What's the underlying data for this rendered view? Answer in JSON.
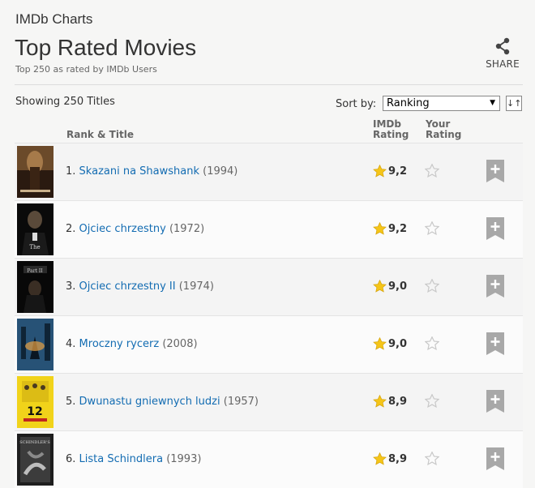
{
  "header": {
    "charts_label": "IMDb Charts",
    "title": "Top Rated Movies",
    "subtitle": "Top 250 as rated by IMDb Users",
    "share_label": "SHARE"
  },
  "toolbar": {
    "showing": "Showing 250 Titles",
    "sort_label": "Sort by:",
    "sort_value": "Ranking",
    "sort_caret": "▼",
    "sort_dir_glyph": "↓↑"
  },
  "columns": {
    "rank_title": "Rank & Title",
    "imdb_rating_1": "IMDb",
    "imdb_rating_2": "Rating",
    "your_rating_1": "Your",
    "your_rating_2": "Rating"
  },
  "colors": {
    "link": "#136cb2",
    "star": "#f5c518",
    "empty_star": "#c8c8c8",
    "watchlist": "#a8a8a8"
  },
  "movies": [
    {
      "rank": "1.",
      "title": "Skazani na Shawshank",
      "year": "(1994)",
      "rating": "9,2",
      "poster_icon": "poster-shawshank"
    },
    {
      "rank": "2.",
      "title": "Ojciec chrzestny",
      "year": "(1972)",
      "rating": "9,2",
      "poster_icon": "poster-godfather"
    },
    {
      "rank": "3.",
      "title": "Ojciec chrzestny II",
      "year": "(1974)",
      "rating": "9,0",
      "poster_icon": "poster-godfather-2"
    },
    {
      "rank": "4.",
      "title": "Mroczny rycerz",
      "year": "(2008)",
      "rating": "9,0",
      "poster_icon": "poster-dark-knight"
    },
    {
      "rank": "5.",
      "title": "Dwunastu gniewnych ludzi",
      "year": "(1957)",
      "rating": "8,9",
      "poster_icon": "poster-12-angry-men"
    },
    {
      "rank": "6.",
      "title": "Lista Schindlera",
      "year": "(1993)",
      "rating": "8,9",
      "poster_icon": "poster-schindlers-list"
    }
  ]
}
